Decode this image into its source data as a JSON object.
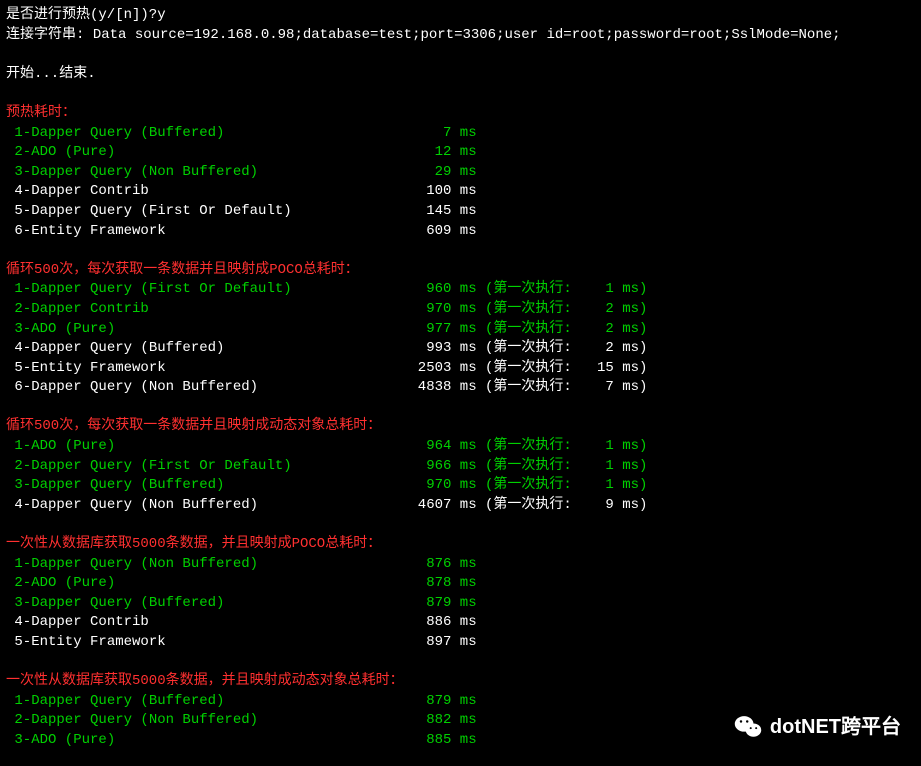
{
  "header": {
    "prompt": "是否进行预热(y/[n])?y",
    "conn_label": "连接字符串: ",
    "conn_value": "Data source=192.168.0.98;database=test;port=3306;user id=root;password=root;SslMode=None;",
    "start_end": "开始...结束."
  },
  "sections": [
    {
      "title": "预热耗时：",
      "rows": [
        {
          "label": " 1-Dapper Query (Buffered)",
          "time": "7",
          "unit": "ms",
          "color": "green"
        },
        {
          "label": " 2-ADO (Pure)",
          "time": "12",
          "unit": "ms",
          "color": "green"
        },
        {
          "label": " 3-Dapper Query (Non Buffered)",
          "time": "29",
          "unit": "ms",
          "color": "green"
        },
        {
          "label": " 4-Dapper Contrib",
          "time": "100",
          "unit": "ms",
          "color": "white"
        },
        {
          "label": " 5-Dapper Query (First Or Default)",
          "time": "145",
          "unit": "ms",
          "color": "white"
        },
        {
          "label": " 6-Entity Framework",
          "time": "609",
          "unit": "ms",
          "color": "white"
        }
      ]
    },
    {
      "title": "循环500次，每次获取一条数据并且映射成POCO总耗时：",
      "rows": [
        {
          "label": " 1-Dapper Query (First Or Default)",
          "time": "960",
          "unit": "ms",
          "extra": "(第一次执行:    1 ms)",
          "color": "green"
        },
        {
          "label": " 2-Dapper Contrib",
          "time": "970",
          "unit": "ms",
          "extra": "(第一次执行:    2 ms)",
          "color": "green"
        },
        {
          "label": " 3-ADO (Pure)",
          "time": "977",
          "unit": "ms",
          "extra": "(第一次执行:    2 ms)",
          "color": "green"
        },
        {
          "label": " 4-Dapper Query (Buffered)",
          "time": "993",
          "unit": "ms",
          "extra": "(第一次执行:    2 ms)",
          "color": "white"
        },
        {
          "label": " 5-Entity Framework",
          "time": "2503",
          "unit": "ms",
          "extra": "(第一次执行:   15 ms)",
          "color": "white"
        },
        {
          "label": " 6-Dapper Query (Non Buffered)",
          "time": "4838",
          "unit": "ms",
          "extra": "(第一次执行:    7 ms)",
          "color": "white"
        }
      ]
    },
    {
      "title": "循环500次，每次获取一条数据并且映射成动态对象总耗时：",
      "rows": [
        {
          "label": " 1-ADO (Pure)",
          "time": "964",
          "unit": "ms",
          "extra": "(第一次执行:    1 ms)",
          "color": "green"
        },
        {
          "label": " 2-Dapper Query (First Or Default)",
          "time": "966",
          "unit": "ms",
          "extra": "(第一次执行:    1 ms)",
          "color": "green"
        },
        {
          "label": " 3-Dapper Query (Buffered)",
          "time": "970",
          "unit": "ms",
          "extra": "(第一次执行:    1 ms)",
          "color": "green"
        },
        {
          "label": " 4-Dapper Query (Non Buffered)",
          "time": "4607",
          "unit": "ms",
          "extra": "(第一次执行:    9 ms)",
          "color": "white"
        }
      ]
    },
    {
      "title": "一次性从数据库获取5000条数据，并且映射成POCO总耗时：",
      "rows": [
        {
          "label": " 1-Dapper Query (Non Buffered)",
          "time": "876",
          "unit": "ms",
          "color": "green"
        },
        {
          "label": " 2-ADO (Pure)",
          "time": "878",
          "unit": "ms",
          "color": "green"
        },
        {
          "label": " 3-Dapper Query (Buffered)",
          "time": "879",
          "unit": "ms",
          "color": "green"
        },
        {
          "label": " 4-Dapper Contrib",
          "time": "886",
          "unit": "ms",
          "color": "white"
        },
        {
          "label": " 5-Entity Framework",
          "time": "897",
          "unit": "ms",
          "color": "white"
        }
      ]
    },
    {
      "title": "一次性从数据库获取5000条数据，并且映射成动态对象总耗时：",
      "rows": [
        {
          "label": " 1-Dapper Query (Buffered)",
          "time": "879",
          "unit": "ms",
          "color": "green"
        },
        {
          "label": " 2-Dapper Query (Non Buffered)",
          "time": "882",
          "unit": "ms",
          "color": "green"
        },
        {
          "label": " 3-ADO (Pure)",
          "time": "885",
          "unit": "ms",
          "color": "green"
        }
      ]
    }
  ],
  "watermark": {
    "text": "dotNET跨平台"
  }
}
